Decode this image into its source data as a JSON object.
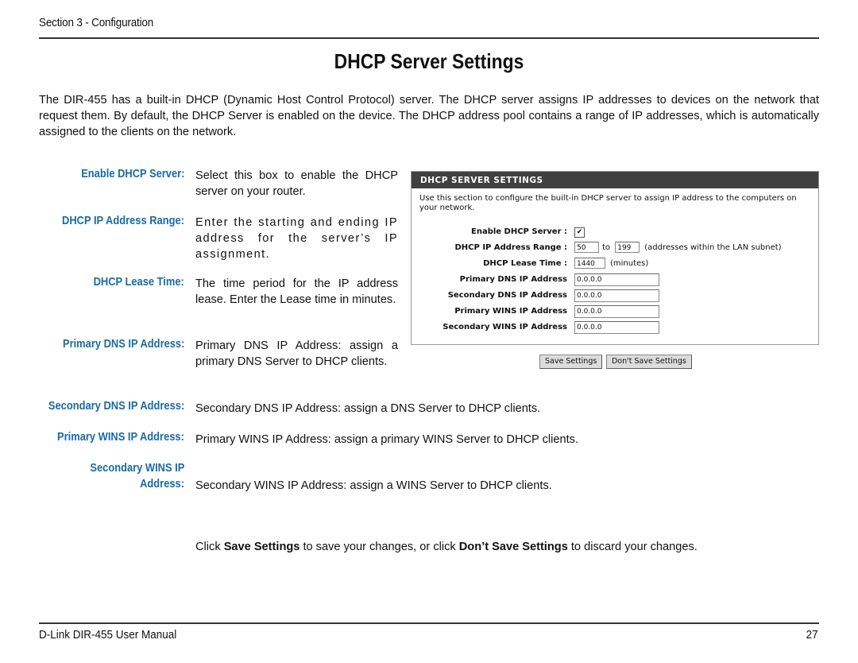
{
  "header": {
    "section": "Section 3 - Configuration"
  },
  "title": "DHCP Server Settings",
  "intro": "The DIR-455 has a built-in DHCP (Dynamic Host Control Protocol) server. The DHCP server assigns IP addresses to devices on the network that request them. By default, the DHCP Server is enabled on the device. The DHCP address pool contains a range of IP addresses, which is automatically assigned to the clients on the network.",
  "definitions": [
    {
      "label": "Enable DHCP Server:",
      "text": "Select this box to enable the DHCP server on your router."
    },
    {
      "label": "DHCP IP Address Range:",
      "text": "Enter the starting and ending IP address for the server’s IP assignment."
    },
    {
      "label": "DHCP Lease Time:",
      "text": "The time period for the IP address lease. Enter the Lease time in minutes."
    },
    {
      "label": "Primary DNS IP Address:",
      "text": "Primary DNS IP Address: assign a primary DNS Server to DHCP clients."
    },
    {
      "label": "Secondary DNS IP Address:",
      "text": "Secondary DNS IP Address: assign a DNS Server to DHCP clients."
    },
    {
      "label": "Primary WINS IP Address:",
      "text": "Primary WINS IP Address: assign a primary WINS Server to DHCP clients."
    },
    {
      "label_line1": "Secondary WINS IP",
      "label_line2": "Address:",
      "text": "Secondary WINS IP Address: assign a WINS Server to DHCP clients."
    }
  ],
  "panel": {
    "heading": "DHCP SERVER SETTINGS",
    "description": "Use this section to configure the built-in DHCP server to assign IP address to the computers on your network.",
    "enable_label": "Enable DHCP Server :",
    "enable_checked": true,
    "check_glyph": "✔",
    "range_label": "DHCP IP Address Range :",
    "range_start": "50",
    "range_to": "to",
    "range_end": "199",
    "range_note": "(addresses within the LAN subnet)",
    "lease_label": "DHCP Lease Time :",
    "lease_value": "1440",
    "lease_note": "(minutes)",
    "primary_dns_label": "Primary DNS IP Address",
    "primary_dns_value": "0.0.0.0",
    "secondary_dns_label": "Secondary DNS IP Address",
    "secondary_dns_value": "0.0.0.0",
    "primary_wins_label": "Primary WINS IP Address",
    "primary_wins_value": "0.0.0.0",
    "secondary_wins_label": "Secondary WINS IP Address",
    "secondary_wins_value": "0.0.0.0",
    "save_button": "Save Settings",
    "dont_save_button": "Don't Save Settings"
  },
  "click_note": {
    "pre": "Click ",
    "save": "Save Settings",
    "mid": " to save your changes, or click ",
    "dont_save": "Don’t Save Settings",
    "post": " to discard your changes."
  },
  "footer": {
    "manual": "D-Link DIR-455 User Manual",
    "page": "27"
  }
}
